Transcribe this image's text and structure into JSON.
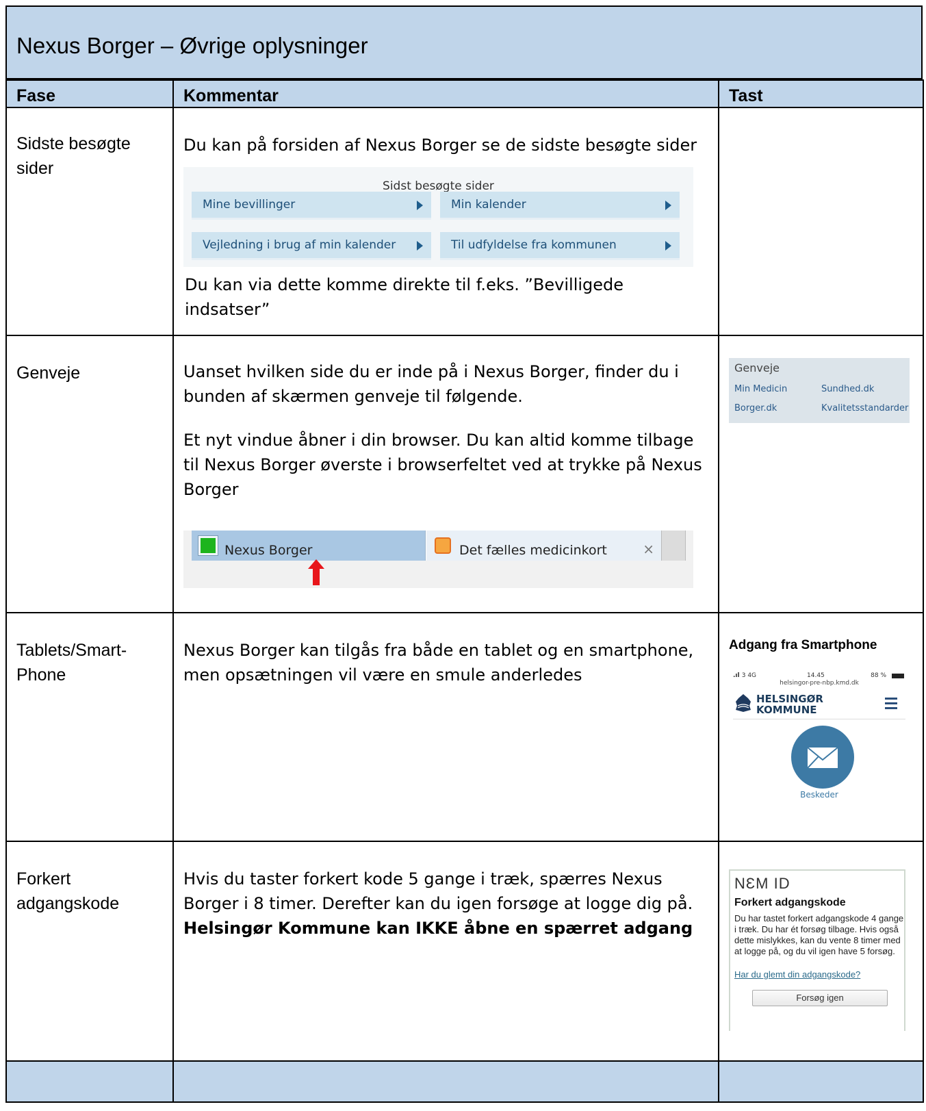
{
  "title": "Nexus Borger – Øvrige oplysninger",
  "headers": {
    "phase": "Fase",
    "comment": "Kommentar",
    "key": "Tast"
  },
  "rows": [
    {
      "phase": "Sidste besøgte sider",
      "comment": "Du kan på forsiden af Nexus Borger se de sidste besøgte sider",
      "widget": {
        "title": "Sidst besøgte sider",
        "buttons": [
          "Mine bevillinger",
          "Min kalender",
          "Vejledning i brug af min kalender",
          "Til udfyldelse fra kommunen"
        ]
      },
      "comment2": "Du kan via dette komme direkte til f.eks. ”Bevilligede indsatser”"
    },
    {
      "phase": "Genveje",
      "comment": "Uanset hvilken side du er inde på i Nexus Borger, finder du i bunden af skærmen genveje til følgende.",
      "comment2": "Et nyt vindue åbner i din browser. Du kan altid komme tilbage til Nexus Borger øverste i browserfeltet ved at trykke på Nexus Borger",
      "browser": {
        "tab1": "Nexus Borger",
        "tab2": "Det fælles medicinkort",
        "close": "×"
      },
      "shortcuts": {
        "title": "Genveje",
        "links": [
          "Min Medicin",
          "Sundhed.dk",
          "Borger.dk",
          "Kvalitetsstandarder"
        ]
      }
    },
    {
      "phase": "Tablets/Smart-Phone",
      "comment": "Nexus Borger kan tilgås fra både en tablet og en smartphone, men opsætningen vil være en smule anderledes",
      "key_title": "Adgang fra Smartphone",
      "phone": {
        "signal": "3 4G",
        "time": "14.45",
        "battery": "88 %",
        "url": "helsingor-pre-nbp.kmd.dk",
        "brand1": "HELSINGØR",
        "brand2": "KOMMUNE",
        "messages": "Beskeder"
      }
    },
    {
      "phase": "Forkert adgangskode",
      "comment": "Hvis du taster forkert kode 5 gange i træk, spærres Nexus Borger i 8 timer. Derefter kan du igen forsøge at logge dig på.",
      "comment_bold": "Helsingør Kommune kan IKKE åbne en spærret adgang",
      "nemid": {
        "logo": "NƐM ID",
        "heading": "Forkert adgangskode",
        "text": "Du har tastet forkert adgangskode 4 gange i træk. Du har ét forsøg tilbage. Hvis også dette mislykkes, kan du vente 8 timer med at logge på, og du vil igen have 5 forsøg.",
        "link": "Har du glemt din adgangskode?",
        "button": "Forsøg igen"
      }
    }
  ]
}
